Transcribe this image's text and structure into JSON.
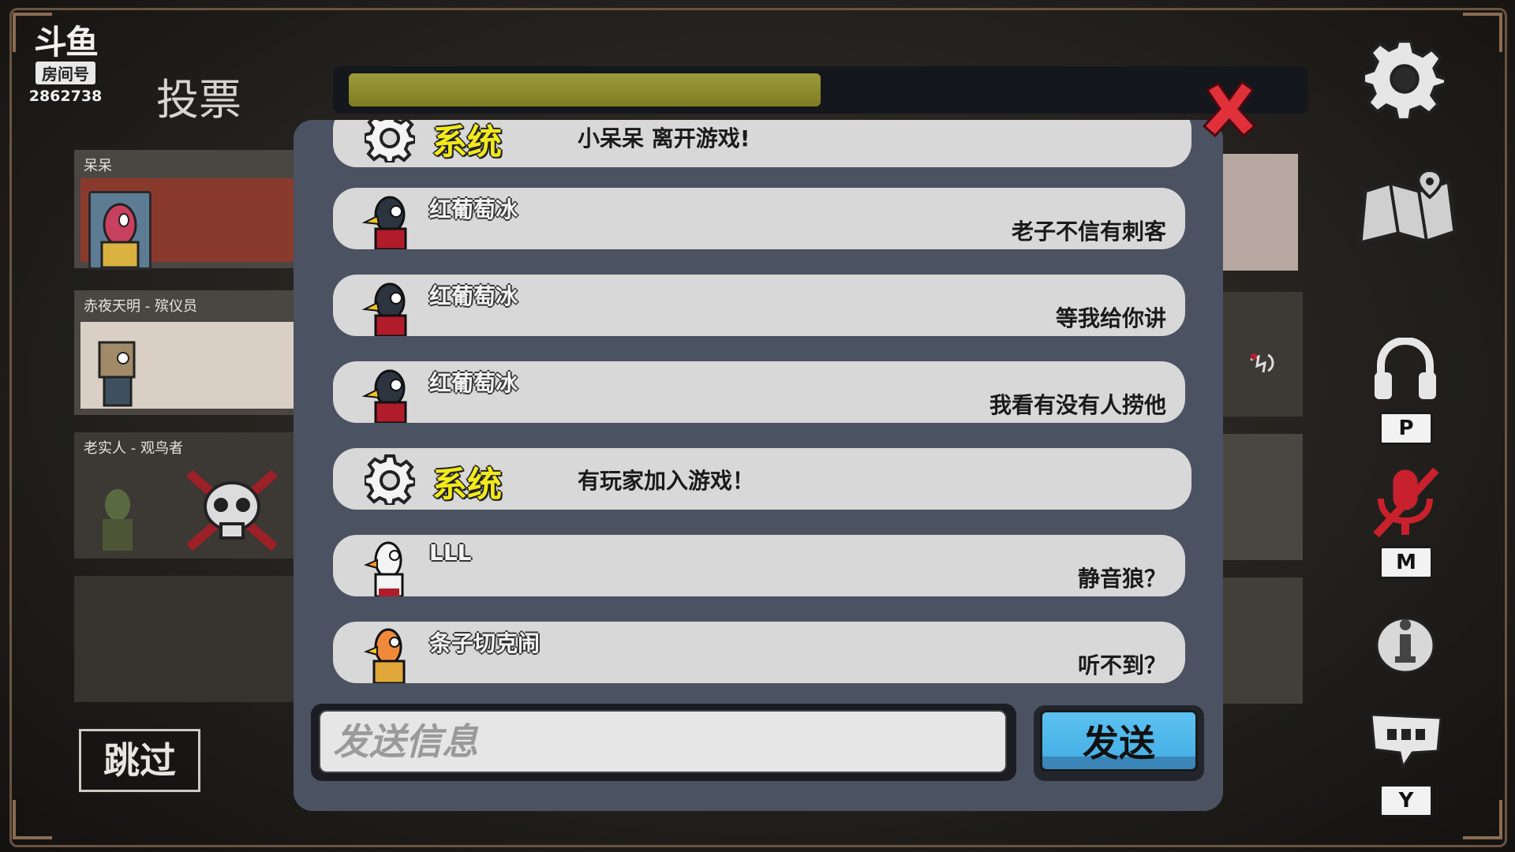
{
  "streamer": {
    "logo": "斗鱼",
    "room_label": "房间号",
    "room_number": "2862738"
  },
  "header": {
    "title": "投票",
    "timer_progress": 0.5
  },
  "players": [
    {
      "name": "呆呆"
    },
    {
      "name": "赤夜天明 - 殡仪员"
    },
    {
      "name": "老实人 - 观鸟者"
    }
  ],
  "skip_label": "跳过",
  "sidebar": {
    "keys": {
      "voice": "P",
      "mic": "M",
      "chat": "Y"
    }
  },
  "chat": {
    "system_label": "系统",
    "messages": [
      {
        "type": "system",
        "text": "小呆呆 离开游戏!"
      },
      {
        "type": "player",
        "name": "红葡萄冰",
        "text": "老子不信有刺客"
      },
      {
        "type": "player",
        "name": "红葡萄冰",
        "text": "等我给你讲"
      },
      {
        "type": "player",
        "name": "红葡萄冰",
        "text": "我看有没有人捞他"
      },
      {
        "type": "system",
        "text": "有玩家加入游戏！"
      },
      {
        "type": "player",
        "name": "LLL",
        "text": "静音狼？"
      },
      {
        "type": "player",
        "name": "条子切克闹",
        "text": "听不到？"
      }
    ],
    "input_placeholder": "发送信息",
    "send_label": "发送"
  },
  "colors": {
    "timer": "#8e8c2e",
    "panel": "#4b5261",
    "send": "#4cb4e8",
    "system": "#f2ea1a",
    "close": "#e0303a"
  }
}
